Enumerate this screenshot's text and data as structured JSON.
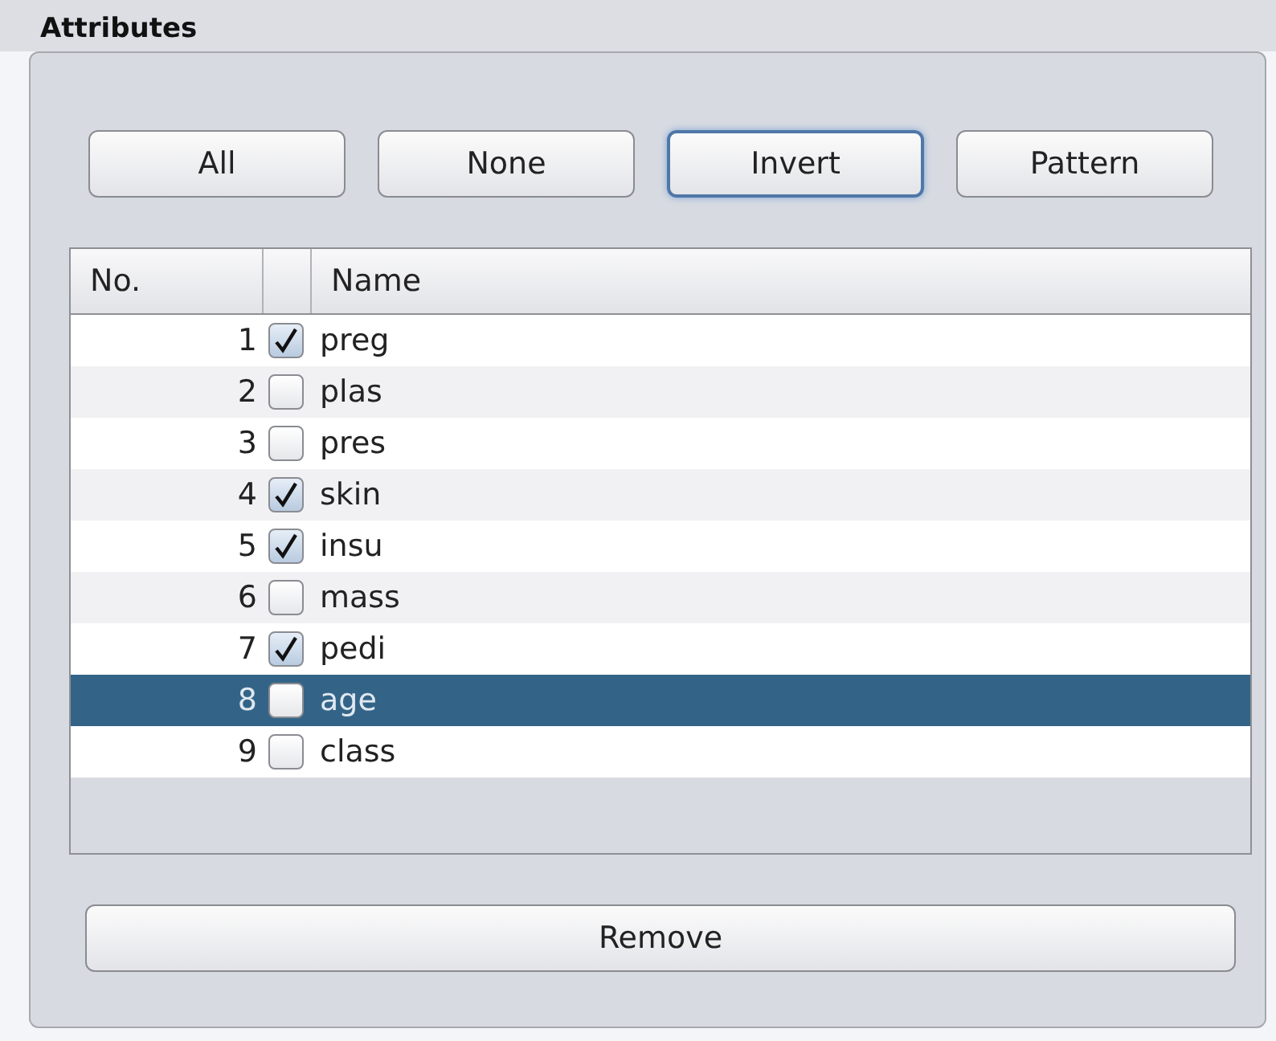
{
  "section_title": "Attributes",
  "buttons": [
    {
      "label": "All",
      "focused": false
    },
    {
      "label": "None",
      "focused": false
    },
    {
      "label": "Invert",
      "focused": true
    },
    {
      "label": "Pattern",
      "focused": false
    }
  ],
  "table": {
    "columns": [
      "No.",
      "",
      "Name"
    ],
    "rows": [
      {
        "no": "1",
        "checked": true,
        "name": "preg",
        "selected": false
      },
      {
        "no": "2",
        "checked": false,
        "name": "plas",
        "selected": false
      },
      {
        "no": "3",
        "checked": false,
        "name": "pres",
        "selected": false
      },
      {
        "no": "4",
        "checked": true,
        "name": "skin",
        "selected": false
      },
      {
        "no": "5",
        "checked": true,
        "name": "insu",
        "selected": false
      },
      {
        "no": "6",
        "checked": false,
        "name": "mass",
        "selected": false
      },
      {
        "no": "7",
        "checked": true,
        "name": "pedi",
        "selected": false
      },
      {
        "no": "8",
        "checked": false,
        "name": "age",
        "selected": true
      },
      {
        "no": "9",
        "checked": false,
        "name": "class",
        "selected": false
      }
    ]
  },
  "remove_button": "Remove"
}
